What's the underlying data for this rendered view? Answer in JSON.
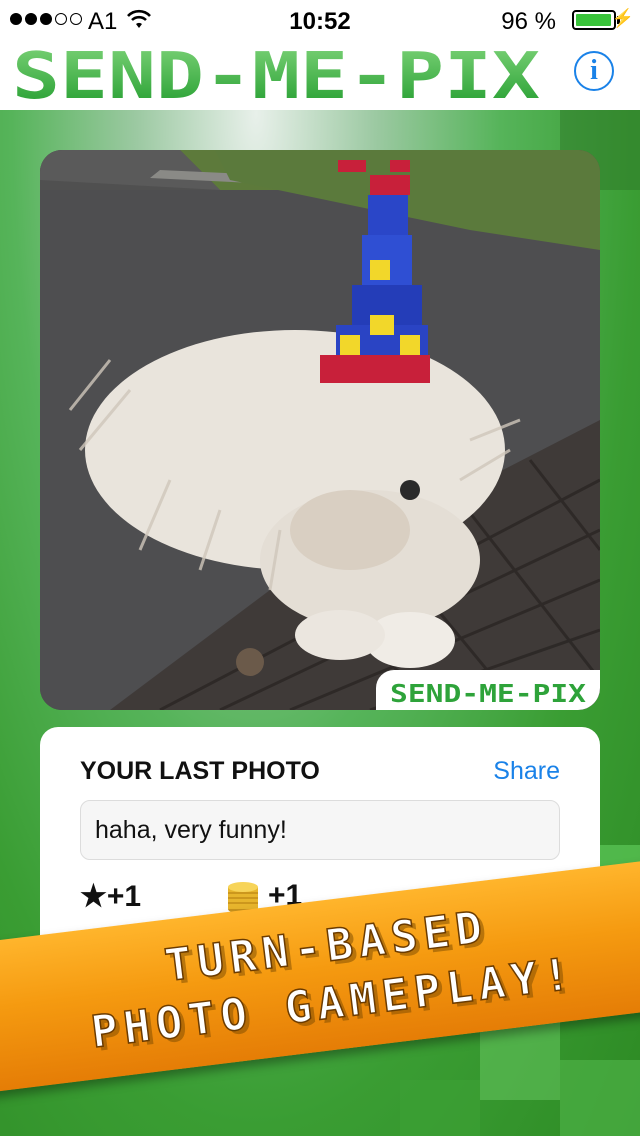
{
  "status_bar": {
    "carrier": "A1",
    "time": "10:52",
    "battery_percent": "96 %",
    "battery_level": 0.96
  },
  "header": {
    "logo_text": "SEND-ME-PIX",
    "info_icon": "info-icon"
  },
  "photo": {
    "watermark_text": "SEND-ME-PIX"
  },
  "last_photo": {
    "title": "YOUR LAST PHOTO",
    "share_label": "Share",
    "comment": "haha, very funny!",
    "stars_reward": "★+1",
    "coins_reward": "+1",
    "coin_icon": "coin-stack-icon"
  },
  "banner": {
    "line1": "TURN-BASED",
    "line2": "PHOTO GAMEPLAY!"
  },
  "colors": {
    "accent": "#1a82e8",
    "logo_green": "#3cb043",
    "banner_orange": "#f59a10"
  }
}
